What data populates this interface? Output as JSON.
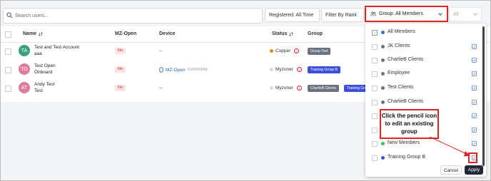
{
  "search": {
    "placeholder": "Search users..."
  },
  "filters": {
    "registered": "Registered: All Time",
    "filter_by_rank": "Filter By Rank",
    "group": "Group: All Members",
    "all": "All"
  },
  "table": {
    "headers": {
      "name": "Name",
      "mz_open": "MZ-Open",
      "device": "Device",
      "status": "Status",
      "group": "Group"
    },
    "rows": [
      {
        "initials": "TA",
        "avatar_color": "#3aa17e",
        "name_line1": "Test and Test Account",
        "name_line2": "aaa",
        "mz_open": "No",
        "device": "--",
        "device_link": "",
        "device_id": "",
        "status": "Copper",
        "status_color": "#e48a1b",
        "groups": [
          "Group Test"
        ]
      },
      {
        "initials": "TO",
        "avatar_color": "#e07c9b",
        "name_line1": "Test Open",
        "name_line2": "Onboard",
        "mz_open": "No",
        "device": "",
        "device_link": "MZ-Open",
        "device_id": "#100000648",
        "status": "Myzoner",
        "status_color": "#d9d9d9",
        "groups": [
          "Training Group B"
        ]
      },
      {
        "initials": "AT",
        "avatar_color": "#e07c9b",
        "name_line1": "Andy Test",
        "name_line2": "Test",
        "mz_open": "No",
        "device": "--",
        "device_link": "",
        "device_id": "",
        "status": "Myzoner",
        "status_color": "#d9d9d9",
        "groups": [
          "CharlieB Clients",
          "Training Group B"
        ]
      }
    ]
  },
  "dropdown": {
    "items": [
      {
        "label": "All Members",
        "color": "#3b6fd8"
      },
      {
        "label": "JK Clients",
        "color": "#6b7280"
      },
      {
        "label": "CharlieB Clients",
        "color": "#6b7280"
      },
      {
        "label": "Employee",
        "color": "#6b7280"
      },
      {
        "label": "Test Clients",
        "color": "#6b7280"
      },
      {
        "label": "CharlieB Clients",
        "color": "#6b7280"
      },
      {
        "label": "",
        "color": "#6b7280"
      },
      {
        "label": "",
        "color": "#6b7280"
      },
      {
        "label": "New Members",
        "color": "#34c759"
      },
      {
        "label": "Training Group B",
        "color": "#3b4fd8"
      }
    ],
    "cancel": "Cancel",
    "apply": "Apply"
  },
  "callout": {
    "text": "Click the pencil icon to edit an existing group"
  },
  "colors": {
    "accent_red": "#e02424",
    "group_test_badge": "#6b7280",
    "training_badge": "#3b4fd8",
    "charlieb_badge": "#6b7280"
  }
}
